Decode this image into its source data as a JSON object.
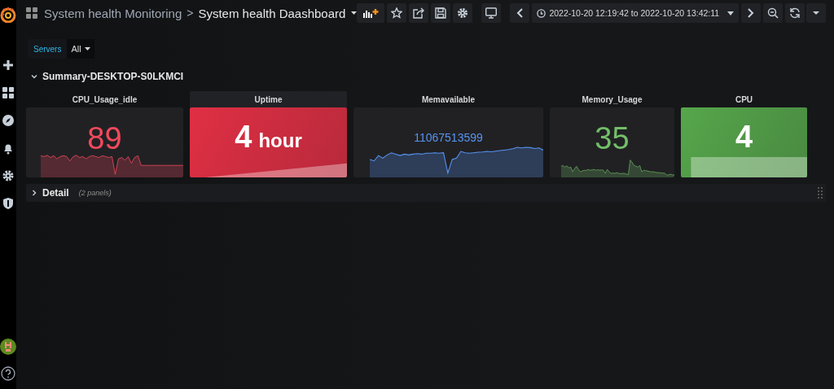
{
  "breadcrumb": {
    "folder": "System health Monitoring",
    "separator": ">",
    "title": "System health Daashboard"
  },
  "time_range": {
    "text": "2022-10-20 12:19:42 to 2022-10-20 13:42:11"
  },
  "variables": [
    {
      "label": "Servers",
      "value": "All"
    }
  ],
  "rows": [
    {
      "title": "Summary-DESKTOP-S0LKMCI",
      "expanded": true,
      "panels": [
        {
          "title": "CPU_Usage_idle",
          "value": "89",
          "kind": "sparkline",
          "color": "#f2495c",
          "hovered": false
        },
        {
          "title": "Uptime",
          "value": "4",
          "unit": "hour",
          "kind": "background",
          "color": "#e02f44",
          "hovered": true
        },
        {
          "title": "Memavailable",
          "value": "11067513599",
          "kind": "sparkline",
          "color": "#5794f2",
          "hovered": false
        },
        {
          "title": "Memory_Usage",
          "value": "35",
          "kind": "sparkline",
          "color": "#73bf69",
          "hovered": false
        },
        {
          "title": "CPU",
          "value": "4",
          "kind": "background",
          "color": "#56a64b",
          "hovered": false
        }
      ]
    },
    {
      "title": "Detail",
      "expanded": false,
      "note": "(2 panels)"
    }
  ]
}
